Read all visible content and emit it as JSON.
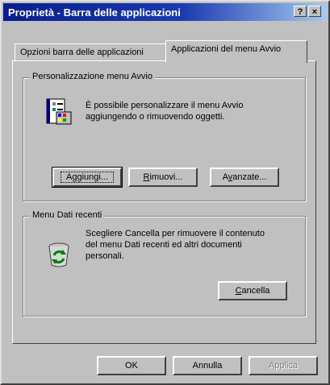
{
  "window": {
    "title": "Proprietà - Barra delle applicazioni",
    "help_label": "?",
    "close_label": "×"
  },
  "tabs": [
    {
      "label": "Opzioni barra delle applicazioni",
      "active": false
    },
    {
      "label": "Applicazioni del menu Avvio",
      "active": true
    }
  ],
  "start_menu_group": {
    "label": "Personalizzazione menu Avvio",
    "description_line1": "È possibile personalizzare il menu Avvio",
    "description_line2": "aggiungendo o rimuovendo oggetti.",
    "buttons": {
      "add": {
        "before": "A",
        "underline": "g",
        "after": "giungi..."
      },
      "remove": {
        "before": "",
        "underline": "R",
        "after": "imuovi..."
      },
      "advanced": {
        "before": "A",
        "underline": "v",
        "after": "anzate..."
      }
    }
  },
  "recent_docs_group": {
    "label": "Menu Dati recenti",
    "description_line1": "Scegliere Cancella per rimuovere il contenuto",
    "description_line2": "del menu Dati recenti ed altri documenti",
    "description_line3": "personali.",
    "clear_button": {
      "before": "",
      "underline": "C",
      "after": "ancella"
    }
  },
  "footer": {
    "ok_label": "OK",
    "cancel_label": "Annulla",
    "apply_label": "Applica"
  }
}
